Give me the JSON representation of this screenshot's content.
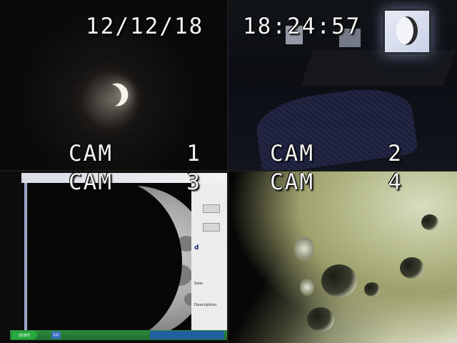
{
  "osd": {
    "date": "12/12/18",
    "time": "18:24:57"
  },
  "cameras": [
    {
      "label": "CAM     1"
    },
    {
      "label": "CAM     2"
    },
    {
      "label": "CAM     3"
    },
    {
      "label": "CAM     4"
    }
  ],
  "cam3_window": {
    "taskbar_start": "start",
    "taskbar_item": "Lu",
    "panel_heading": "d",
    "panel_size": "Size:",
    "panel_description": "Description"
  },
  "colors": {
    "osd_text": "#f2f2f2",
    "taskbar": "#1f6d2e",
    "lunar_highlight": "#d9dbc4"
  }
}
